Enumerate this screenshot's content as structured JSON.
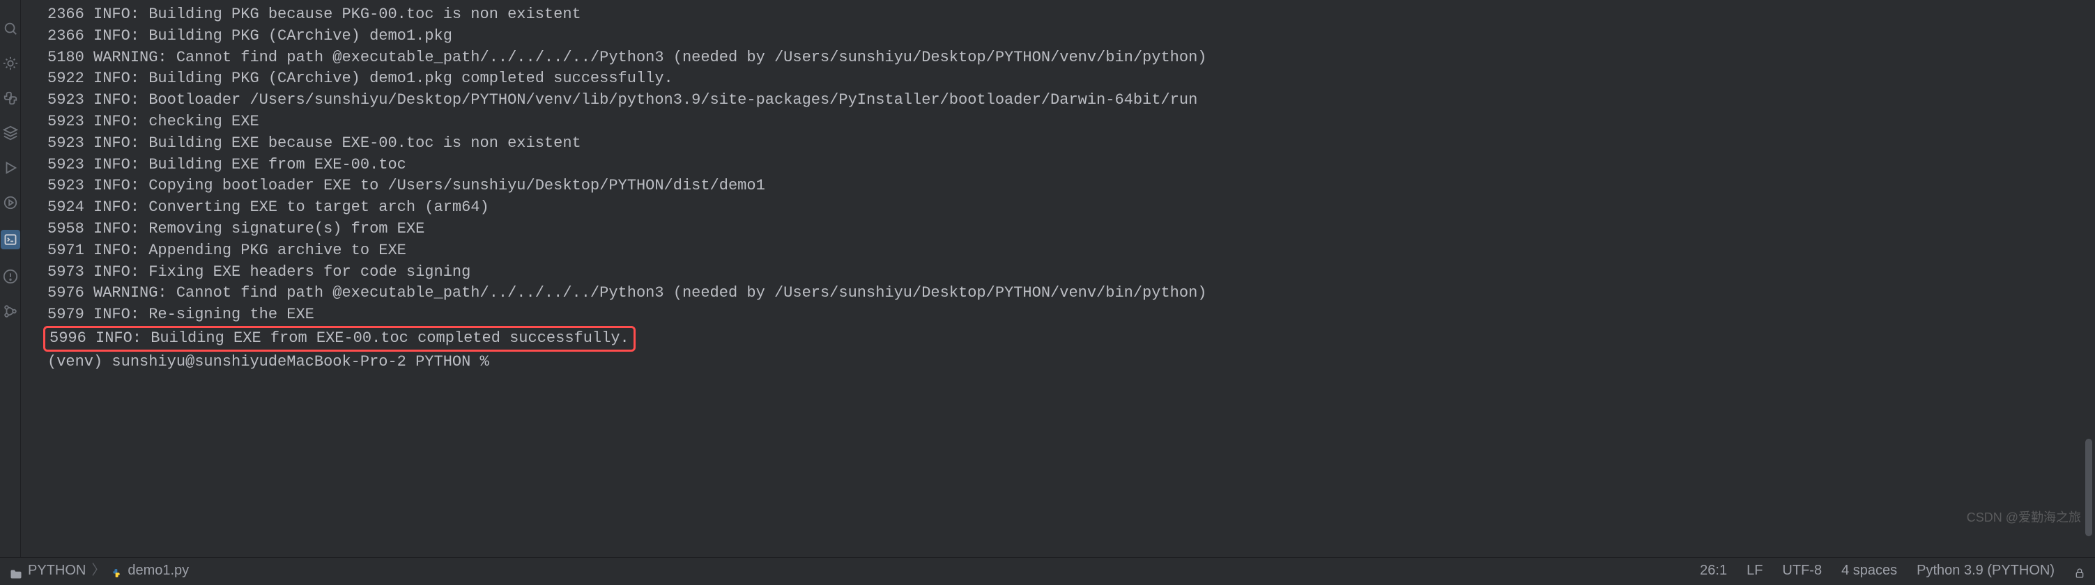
{
  "terminal": {
    "lines": [
      "2366 INFO: Building PKG because PKG-00.toc is non existent",
      "2366 INFO: Building PKG (CArchive) demo1.pkg",
      "5180 WARNING: Cannot find path @executable_path/../../../../Python3 (needed by /Users/sunshiyu/Desktop/PYTHON/venv/bin/python)",
      "5922 INFO: Building PKG (CArchive) demo1.pkg completed successfully.",
      "5923 INFO: Bootloader /Users/sunshiyu/Desktop/PYTHON/venv/lib/python3.9/site-packages/PyInstaller/bootloader/Darwin-64bit/run",
      "5923 INFO: checking EXE",
      "5923 INFO: Building EXE because EXE-00.toc is non existent",
      "5923 INFO: Building EXE from EXE-00.toc",
      "5923 INFO: Copying bootloader EXE to /Users/sunshiyu/Desktop/PYTHON/dist/demo1",
      "5924 INFO: Converting EXE to target arch (arm64)",
      "5958 INFO: Removing signature(s) from EXE",
      "5971 INFO: Appending PKG archive to EXE",
      "5973 INFO: Fixing EXE headers for code signing",
      "5976 WARNING: Cannot find path @executable_path/../../../../Python3 (needed by /Users/sunshiyu/Desktop/PYTHON/venv/bin/python)",
      "5979 INFO: Re-signing the EXE"
    ],
    "highlighted_line": "5996 INFO: Building EXE from EXE-00.toc completed successfully.",
    "prompt_line": "(venv) sunshiyu@sunshiyudeMacBook-Pro-2 PYTHON % "
  },
  "statusbar": {
    "breadcrumb_root": "PYTHON",
    "breadcrumb_file": "demo1.py",
    "cursor": "26:1",
    "line_sep": "LF",
    "encoding": "UTF-8",
    "indent": "4 spaces",
    "interpreter": "Python 3.9 (PYTHON)"
  },
  "watermark": "CSDN @爱勤海之旅"
}
